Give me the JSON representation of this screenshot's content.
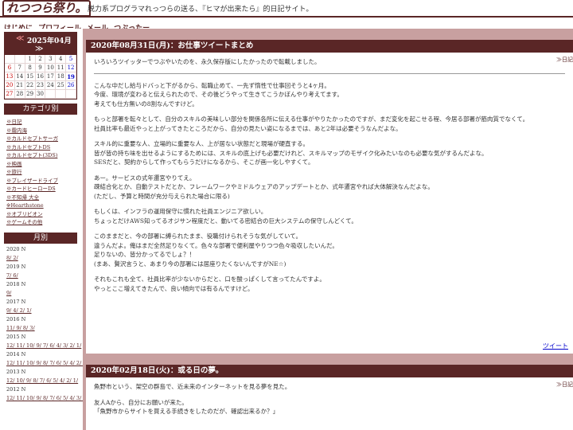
{
  "header": {
    "logo": "れつつら祭り。",
    "tagline": "脱力系プログラマれっつらの送る、『ヒマが出来たら』的日記サイト。"
  },
  "nav": [
    "はじめに",
    "プロフィール",
    "メール",
    "つぶったー"
  ],
  "calendar": {
    "prev": "≪",
    "title": "2025年04月",
    "next": "≫",
    "weeks": [
      [
        "",
        "",
        "1",
        "2",
        "3",
        "4",
        "5"
      ],
      [
        "6",
        "7",
        "8",
        "9",
        "10",
        "11",
        "12"
      ],
      [
        "13",
        "14",
        "15",
        "16",
        "17",
        "18",
        "19"
      ],
      [
        "20",
        "21",
        "22",
        "23",
        "24",
        "25",
        "26"
      ],
      [
        "27",
        "28",
        "29",
        "30",
        "",
        "",
        ""
      ]
    ]
  },
  "categories": {
    "title": "カテゴリ別",
    "items": [
      "※日記",
      "※霧内海",
      "※カルドセプトサーガ",
      "※カルドセプトDS",
      "※カルドセプト(3DS)",
      "※映画",
      "※旅行",
      "※ブレイザードライブ",
      "※カードヒーローDS",
      "※不知帰 大全",
      "※Hearthstone",
      "※オブリビオン",
      "※ゲームその他"
    ]
  },
  "months": {
    "title": "月別",
    "groups": [
      {
        "year": "2020  N",
        "links": "8/ 2/"
      },
      {
        "year": "2019  N",
        "links": "7/ 6/"
      },
      {
        "year": "2018  N",
        "links": "9/"
      },
      {
        "year": "2017  N",
        "links": "9/ 4/ 2/ 1/"
      },
      {
        "year": "2016  N",
        "links": "11/ 9/ 8/ 3/"
      },
      {
        "year": "2015  N",
        "links": "12/ 11/ 10/ 9/ 7/ 6/ 4/ 3/ 2/ 1/"
      },
      {
        "year": "2014  N",
        "links": "12/ 11/ 10/ 9/ 8/ 7/ 6/ 5/ 4/ 2/ 1/"
      },
      {
        "year": "2013  N",
        "links": "12/ 10/ 9/ 8/ 7/ 6/ 5/ 4/ 2/ 1/"
      },
      {
        "year": "2012  N",
        "links": "12/ 11/ 10/ 9/ 8/ 7/ 6/ 5/ 4/ 3/ 2/ 1/"
      }
    ]
  },
  "posts": [
    {
      "title": "2020年08月31日(月)：お仕事ツイートまとめ",
      "category": "≫日記",
      "intro": "いろいろツイッターでつぶやいたのを、永久保存版にしたかったので転載しました。",
      "paragraphs": [
        [
          "こんな中だし給与ドバっと下がるから、転職止めて、一先ず惰性で仕事回そうと4ヶ月。",
          "今度、環境が変わると伝えられたので、その後どうやって生きてこうかぼんやり考えてます。",
          "考えても仕方無いの8割なんですけど。"
        ],
        [
          "もっと部署を転々として、自分のスキルの美味しい部分を関係各所に伝える仕事がやりたかったのですが、まだ変化を起こせる程、今居る部署が筋肉質でなくて。",
          "社員比率も最近やっと上がってきたところだから、自分の見たい姿になるまでは、あと2年は必要そうなんだよな。"
        ],
        [
          "スキル的に重要な人、立場的に重要な人、上が居ない状態だと現場が硬直する。",
          "皆が皆の持ち味を出せるようにするためには、スキルの底上げも必要だけれど、スキルマップのモザイク化みたいなのも必要な気がするんだよな。",
          "SESだと、契約からして作ってもらうだけになるから、そこが画一化しやすくて。"
        ],
        [
          "あー。サービスの式年遷宮やりてえ。",
          "疎結合化とか、自動テストだとか、フレームワークやミドルウェアのアップデートとか、式年遷宮やれば大体解決なんだよな。",
          "(ただし、予算と時間が充分与えられた場合に限る)"
        ],
        [
          "もしくは、インフラの運用保守に慣れた社員エンジニア欲しい。",
          "ちょっとだけAWS知ってるオジサン程度だと、動いてる密結合の巨大システムの保守しんどくて。"
        ],
        [
          "このままだと、今の部署に縛られたまま、役職付けられそうな気がしていて。",
          "違うんだよ。俺はまだ全然足りなくて。色々な部署で便利屋やりつつ色々吸収したいんだ。",
          "足りないの、皆分かってるでしょ？！",
          "(まあ、贅沢言うと、あまり今の部署には居座りたくないんですがNE☆)"
        ],
        [
          "それもこれも全て、社員比率が少ないからだと、口を酸っぱくして言ってたんですよ。",
          "やっとここ増えてきたんで、良い傾向では有るんですけど。"
        ]
      ],
      "footer": "ツイート"
    },
    {
      "title": "2020年02月18日(火)：或る日の夢。",
      "category": "≫日記",
      "paragraphs": [
        [
          "魚野市という、架空の群島で、近未来のインターネットを見る夢を見た。"
        ],
        [
          "友人Aから、自分にお願いが来た。",
          "「魚野市からサイトを買える手続きをしたのだが、確認出来るか？」"
        ]
      ]
    }
  ]
}
